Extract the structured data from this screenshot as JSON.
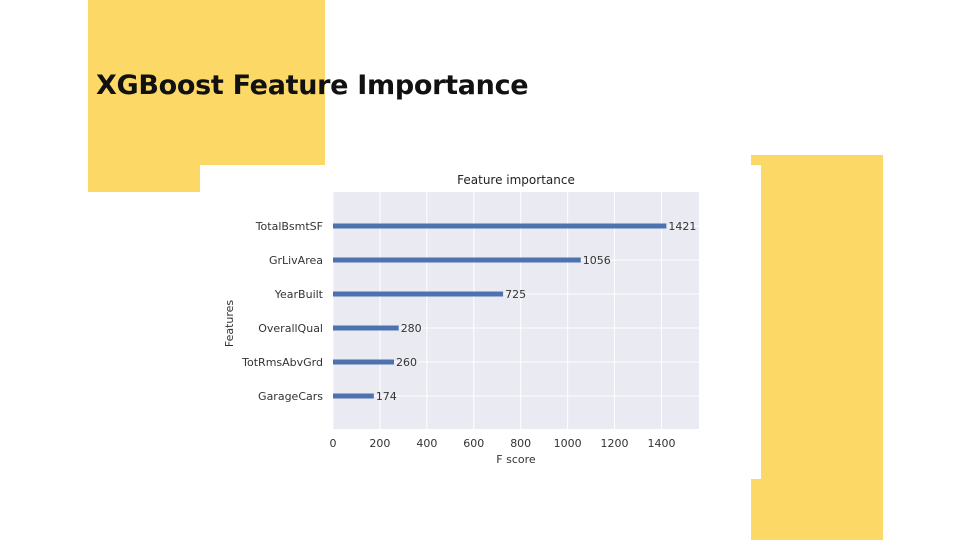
{
  "slide": {
    "title": "XGBoost Feature Importance",
    "accent_color": "#fcd967"
  },
  "chart_data": {
    "type": "bar",
    "orientation": "horizontal",
    "title": "Feature importance",
    "xlabel": "F score",
    "ylabel": "Features",
    "categories": [
      "TotalBsmtSF",
      "GrLivArea",
      "YearBuilt",
      "OverallQual",
      "TotRmsAbvGrd",
      "GarageCars"
    ],
    "values": [
      1421,
      1056,
      725,
      280,
      260,
      174
    ],
    "xlim": [
      0,
      1560
    ],
    "xticks": [
      0,
      200,
      400,
      600,
      800,
      1000,
      1200,
      1400
    ],
    "grid": true,
    "bar_color": "#4c72b0",
    "plot_background": "#eaeaf2",
    "gridline_color": "#ffffff"
  }
}
